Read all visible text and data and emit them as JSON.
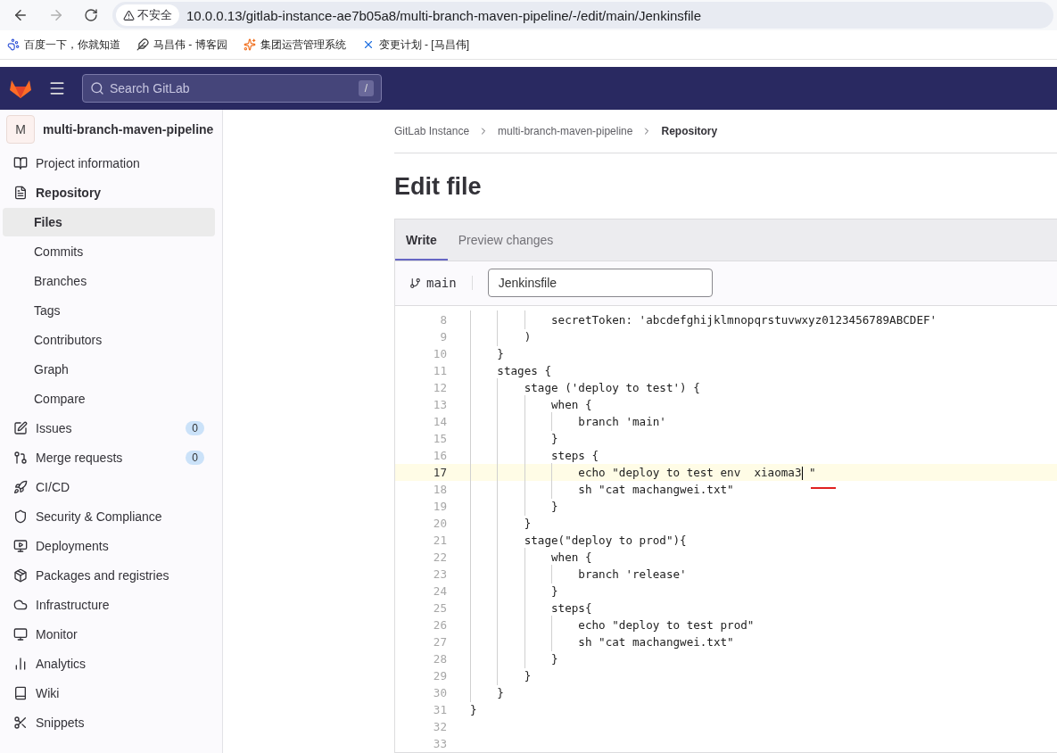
{
  "browser": {
    "security": "不安全",
    "url": "10.0.0.13/gitlab-instance-ae7b05a8/multi-branch-maven-pipeline/-/edit/main/Jenkinsfile"
  },
  "bookmarks": [
    {
      "kind": "paw",
      "label": "百度一下，你就知道"
    },
    {
      "kind": "blog",
      "label": "马昌伟 - 博客园"
    },
    {
      "kind": "spark",
      "label": "集团运营管理系统"
    },
    {
      "kind": "cross",
      "label": "变更计划 - [马昌伟]"
    }
  ],
  "header": {
    "search": {
      "placeholder": "Search GitLab",
      "shortcut": "/"
    }
  },
  "project": {
    "avatar": "M",
    "name": "multi-branch-maven-pipeline"
  },
  "sidebar": {
    "items": [
      {
        "kind": "info",
        "label": "Project information",
        "selected": false,
        "sub": false
      },
      {
        "kind": "repo",
        "label": "Repository",
        "selected": false,
        "sub": false,
        "bold": true
      },
      {
        "kind": "none",
        "label": "Files",
        "selected": true,
        "sub": true
      },
      {
        "kind": "none",
        "label": "Commits",
        "selected": false,
        "sub": true
      },
      {
        "kind": "none",
        "label": "Branches",
        "selected": false,
        "sub": true
      },
      {
        "kind": "none",
        "label": "Tags",
        "selected": false,
        "sub": true
      },
      {
        "kind": "none",
        "label": "Contributors",
        "selected": false,
        "sub": true
      },
      {
        "kind": "none",
        "label": "Graph",
        "selected": false,
        "sub": true
      },
      {
        "kind": "none",
        "label": "Compare",
        "selected": false,
        "sub": true
      },
      {
        "kind": "issues",
        "label": "Issues",
        "selected": false,
        "sub": false,
        "count": "0"
      },
      {
        "kind": "merge",
        "label": "Merge requests",
        "selected": false,
        "sub": false,
        "count": "0"
      },
      {
        "kind": "rocket",
        "label": "CI/CD",
        "selected": false,
        "sub": false
      },
      {
        "kind": "shield",
        "label": "Security & Compliance",
        "selected": false,
        "sub": false
      },
      {
        "kind": "deploy",
        "label": "Deployments",
        "selected": false,
        "sub": false
      },
      {
        "kind": "package",
        "label": "Packages and registries",
        "selected": false,
        "sub": false
      },
      {
        "kind": "cloud",
        "label": "Infrastructure",
        "selected": false,
        "sub": false
      },
      {
        "kind": "monitor",
        "label": "Monitor",
        "selected": false,
        "sub": false
      },
      {
        "kind": "chart",
        "label": "Analytics",
        "selected": false,
        "sub": false
      },
      {
        "kind": "book",
        "label": "Wiki",
        "selected": false,
        "sub": false
      },
      {
        "kind": "scissors",
        "label": "Snippets",
        "selected": false,
        "sub": false
      }
    ]
  },
  "breadcrumbs": [
    "GitLab Instance",
    "multi-branch-maven-pipeline",
    "Repository"
  ],
  "title": "Edit file",
  "tabs": [
    {
      "label": "Write",
      "selected": true
    },
    {
      "label": "Preview changes",
      "selected": false
    }
  ],
  "branch": "main",
  "file_name": "Jenkinsfile",
  "code": [
    {
      "number": "8",
      "text": "            secretToken: 'abcdefghijklmnopqrstuvwxyz0123456789ABCDEF'",
      "active": false
    },
    {
      "number": "9",
      "text": "        )",
      "active": false
    },
    {
      "number": "10",
      "text": "    }",
      "active": false
    },
    {
      "number": "11",
      "text": "    stages {",
      "active": false
    },
    {
      "number": "12",
      "text": "        stage ('deploy to test') {",
      "active": false
    },
    {
      "number": "13",
      "text": "            when {",
      "active": false
    },
    {
      "number": "14",
      "text": "                branch 'main'",
      "active": false
    },
    {
      "number": "15",
      "text": "            }",
      "active": false
    },
    {
      "number": "16",
      "text": "            steps {",
      "active": false
    },
    {
      "number": "17",
      "text": "                echo \"deploy to test env  xiaoma3 \"",
      "active": true
    },
    {
      "number": "18",
      "text": "                sh \"cat machangwei.txt\"",
      "active": false
    },
    {
      "number": "19",
      "text": "            }",
      "active": false
    },
    {
      "number": "20",
      "text": "        }",
      "active": false
    },
    {
      "number": "21",
      "text": "        stage(\"deploy to prod\"){",
      "active": false
    },
    {
      "number": "22",
      "text": "            when {",
      "active": false
    },
    {
      "number": "23",
      "text": "                branch 'release'",
      "active": false
    },
    {
      "number": "24",
      "text": "            }",
      "active": false
    },
    {
      "number": "25",
      "text": "            steps{",
      "active": false
    },
    {
      "number": "26",
      "text": "                echo \"deploy to test prod\"",
      "active": false
    },
    {
      "number": "27",
      "text": "                sh \"cat machangwei.txt\"",
      "active": false
    },
    {
      "number": "28",
      "text": "            }",
      "active": false
    },
    {
      "number": "29",
      "text": "        }",
      "active": false
    },
    {
      "number": "30",
      "text": "    }",
      "active": false
    },
    {
      "number": "31",
      "text": "}",
      "active": false
    },
    {
      "number": "32",
      "active": false
    },
    {
      "number": "33",
      "active": false
    }
  ]
}
